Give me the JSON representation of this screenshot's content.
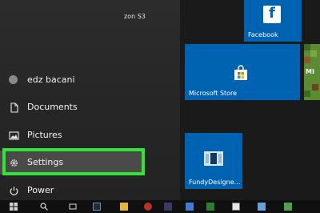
{
  "start_menu": {
    "partial_app_label": "zon S3",
    "user": {
      "name": "edz bacani",
      "icon": "avatar-icon"
    },
    "items": [
      {
        "label": "Documents",
        "icon": "document-icon"
      },
      {
        "label": "Pictures",
        "icon": "picture-icon"
      },
      {
        "label": "Settings",
        "icon": "gear-icon"
      },
      {
        "label": "Power",
        "icon": "power-icon"
      }
    ]
  },
  "tiles": [
    {
      "label": "Facebook",
      "icon": "facebook-icon"
    },
    {
      "label": "Microsoft Store",
      "icon": "store-bag-icon"
    },
    {
      "label": "FundyDesigne...",
      "icon": "fundy-app-icon"
    }
  ],
  "partial_tile_text": "MI",
  "colors": {
    "tile_blue": "#0063b1",
    "highlight_green": "#2ee633",
    "settings_row_bg": "#4a4a4a"
  },
  "taskbar": {
    "icons": [
      "windows-icon",
      "search-icon",
      "task-view-icon",
      "app-icon",
      "folder-icon",
      "app-icon",
      "app-icon",
      "app-icon",
      "app-icon",
      "app-icon",
      "app-icon",
      "app-icon"
    ]
  }
}
